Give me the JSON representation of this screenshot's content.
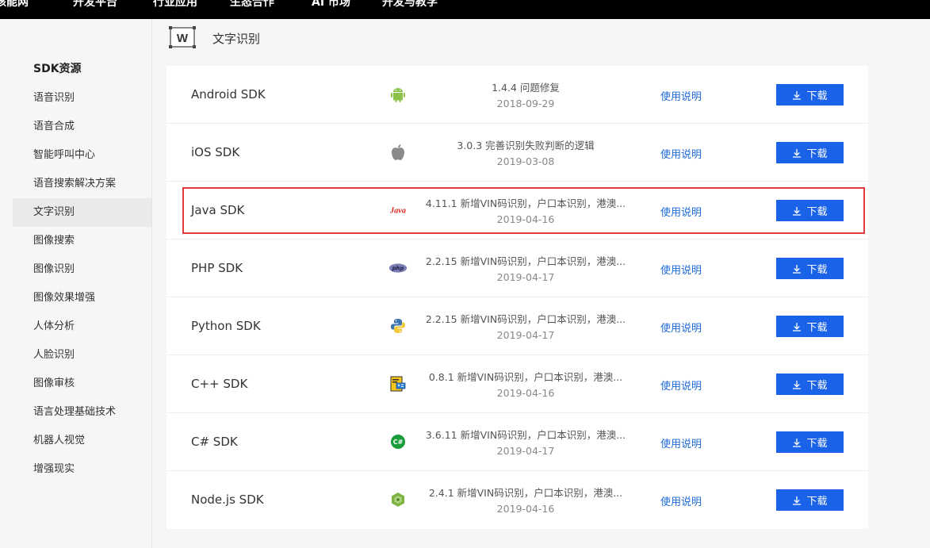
{
  "topbar": {
    "items": [
      "核能网",
      "开发平台",
      "行业应用",
      "生态合作",
      "AI 市场",
      "开发与教学"
    ]
  },
  "sidebar": {
    "title": "SDK资源",
    "items": [
      {
        "label": "语音识别"
      },
      {
        "label": "语音合成"
      },
      {
        "label": "智能呼叫中心"
      },
      {
        "label": "语音搜索解决方案"
      },
      {
        "label": "文字识别",
        "active": true
      },
      {
        "label": "图像搜索"
      },
      {
        "label": "图像识别"
      },
      {
        "label": "图像效果增强"
      },
      {
        "label": "人体分析"
      },
      {
        "label": "人脸识别"
      },
      {
        "label": "图像审核"
      },
      {
        "label": "语言处理基础技术"
      },
      {
        "label": "机器人视觉"
      },
      {
        "label": "增强现实"
      }
    ]
  },
  "section": {
    "icon_letter": "W",
    "title": "文字识别"
  },
  "labels": {
    "doc_link": "使用说明",
    "download": "下载"
  },
  "sdks": [
    {
      "name": "Android SDK",
      "logo": "android-icon",
      "note": "1.4.4 问题修复",
      "date": "2018-09-29"
    },
    {
      "name": "iOS SDK",
      "logo": "apple-icon",
      "note": "3.0.3 完善识别失败判断的逻辑",
      "date": "2019-03-08"
    },
    {
      "name": "Java SDK",
      "logo": "java-icon",
      "logo_text": "Java",
      "note": "4.11.1 新增VIN码识别，户口本识别，港澳...",
      "date": "2019-04-16"
    },
    {
      "name": "PHP SDK",
      "logo": "php-icon",
      "logo_text": "php",
      "note": "2.2.15 新增VIN码识别，户口本识别，港澳...",
      "date": "2019-04-17"
    },
    {
      "name": "Python SDK",
      "logo": "python-icon",
      "note": "2.2.15 新增VIN码识别，户口本识别，港澳...",
      "date": "2019-04-17"
    },
    {
      "name": "C++ SDK",
      "logo": "cpp-icon",
      "note": "0.8.1 新增VIN码识别，户口本识别，港澳...",
      "date": "2019-04-16"
    },
    {
      "name": "C# SDK",
      "logo": "csharp-icon",
      "logo_text": "C#",
      "note": "3.6.11 新增VIN码识别，户口本识别，港澳...",
      "date": "2019-04-17"
    },
    {
      "name": "Node.js SDK",
      "logo": "nodejs-icon",
      "note": "2.4.1 新增VIN码识别，户口本识别，港澳...",
      "date": "2019-04-16"
    }
  ],
  "colors": {
    "accent": "#1a63e8",
    "link": "#1e6ad6",
    "highlight": "#e03a3a"
  }
}
